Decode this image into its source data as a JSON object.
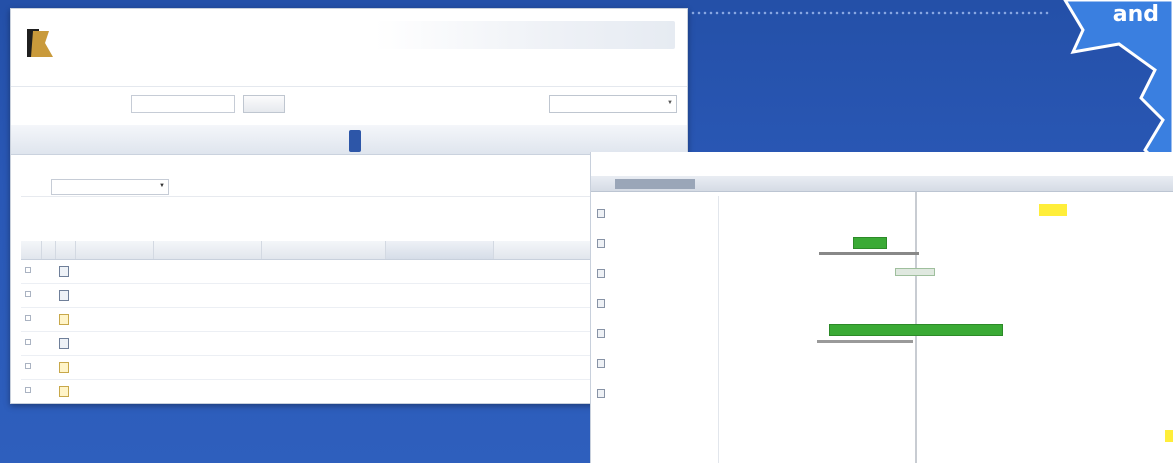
{
  "decor": {
    "corner_text": "and"
  },
  "file_manager": {
    "logo_text": [
      "",
      ""
    ],
    "header_right": {
      "title": "",
      "user": "",
      "links": ""
    },
    "search": {
      "label": "",
      "placeholder": "",
      "button": ""
    },
    "filter": {
      "value": ""
    },
    "nav": {
      "title": "",
      "tabs": [
        "",
        "",
        "",
        "",
        "",
        "",
        "",
        "",
        ""
      ],
      "active_index": 0
    },
    "section_label": "",
    "toolbar": {
      "label": "",
      "select_value": ""
    },
    "actions": [
      "",
      ""
    ],
    "table": {
      "headers": [
        "",
        "",
        "",
        "",
        "",
        "",
        "",
        ""
      ],
      "rows": [
        {
          "type": "doc",
          "cells": [
            "",
            "",
            "",
            "",
            ""
          ]
        },
        {
          "type": "doc",
          "cells": [
            "",
            "",
            "",
            "",
            ""
          ]
        },
        {
          "type": "img",
          "cells": [
            "",
            "",
            "",
            "",
            ""
          ]
        },
        {
          "type": "doc",
          "cells": [
            "",
            "",
            "",
            "",
            ""
          ]
        },
        {
          "type": "img",
          "cells": [
            "",
            "",
            "",
            "",
            ""
          ]
        },
        {
          "type": "img",
          "cells": [
            "",
            "",
            "",
            "",
            ""
          ]
        }
      ]
    }
  },
  "gantt": {
    "header": {
      "left": "",
      "middle": "",
      "right": ""
    },
    "timeline": [
      "",
      "",
      "",
      "",
      "",
      ""
    ],
    "tasks": [
      {
        "name": "",
        "value": ""
      },
      {
        "name": "",
        "value": ""
      },
      {
        "name": "",
        "value": ""
      },
      {
        "name": "",
        "value": ""
      },
      {
        "name": "",
        "value": ""
      },
      {
        "name": "",
        "value": ""
      },
      {
        "name": "",
        "value": ""
      }
    ],
    "colors": {
      "bar": "#3aaa35",
      "highlight": "#ffee3a",
      "accent": "#2d56a8"
    }
  }
}
